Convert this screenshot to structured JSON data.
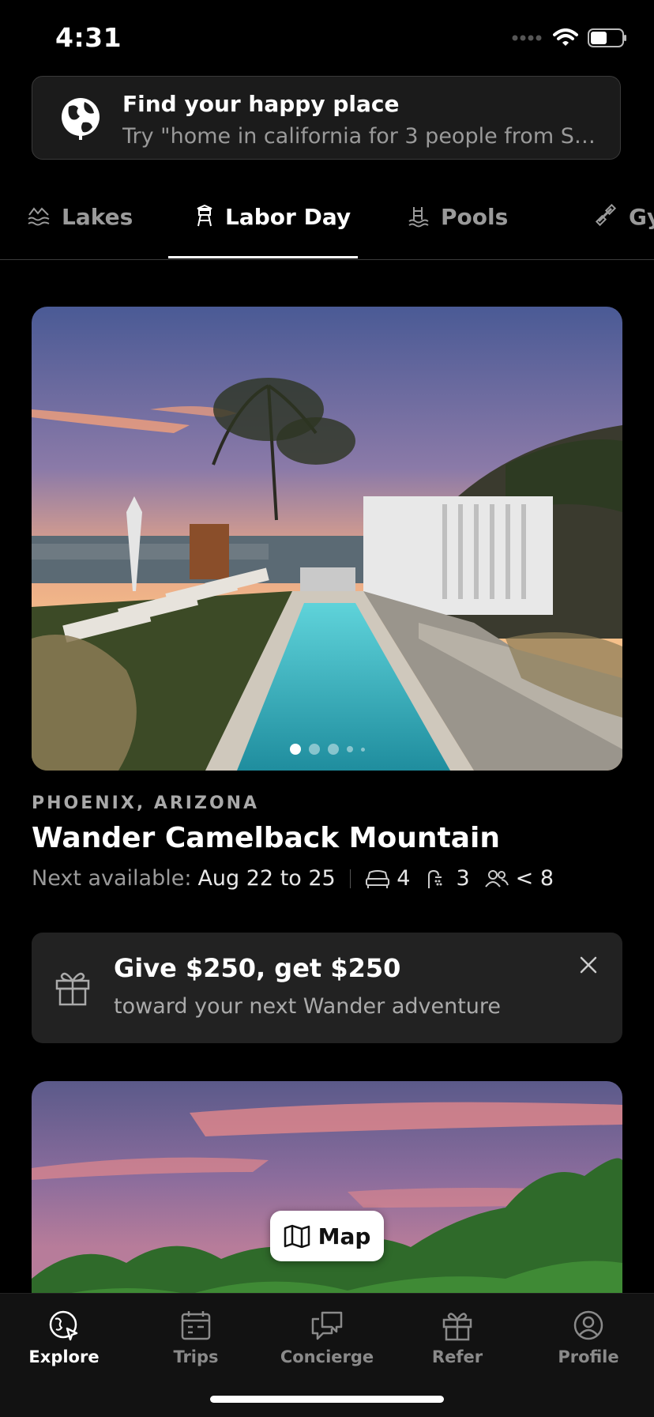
{
  "status_bar": {
    "time": "4:31"
  },
  "search": {
    "title": "Find your happy place",
    "hint": "Try \"home in california for 3 people from Se..."
  },
  "tabs": [
    {
      "label": "Lakes",
      "icon": "lake-icon",
      "active": false
    },
    {
      "label": "Labor Day",
      "icon": "lifeguard-tower-icon",
      "active": true
    },
    {
      "label": "Pools",
      "icon": "pool-ladder-icon",
      "active": false
    },
    {
      "label": "Gy",
      "icon": "dumbbell-icon",
      "active": false
    }
  ],
  "listing": {
    "location": "PHOENIX, ARIZONA",
    "name": "Wander Camelback Mountain",
    "next_label": "Next available:",
    "dates": "Aug 22 to 25",
    "beds": "4",
    "baths": "3",
    "guests": "< 8",
    "photo_index": 1,
    "photo_count": 5
  },
  "referral": {
    "title": "Give $250, get $250",
    "subtitle": "toward your next Wander adventure"
  },
  "map_button": {
    "label": "Map"
  },
  "nav": {
    "items": [
      {
        "label": "Explore",
        "icon": "explore-icon",
        "active": true
      },
      {
        "label": "Trips",
        "icon": "calendar-icon",
        "active": false
      },
      {
        "label": "Concierge",
        "icon": "chat-icon",
        "active": false
      },
      {
        "label": "Refer",
        "icon": "gift-icon",
        "active": false
      },
      {
        "label": "Profile",
        "icon": "user-icon",
        "active": false
      }
    ]
  },
  "colors": {
    "background": "#000000",
    "card": "#1b1b1b",
    "muted_text": "#9a9a9a",
    "pool": "#2bb3c0",
    "sunset": "#f2a074"
  }
}
